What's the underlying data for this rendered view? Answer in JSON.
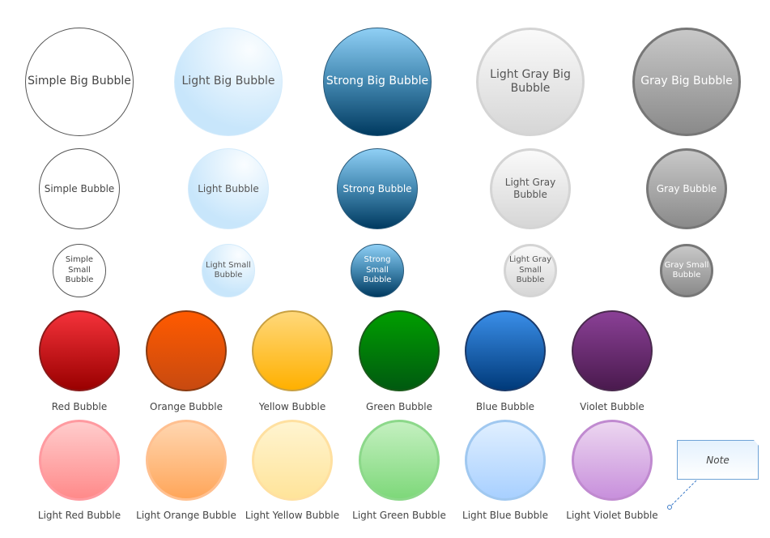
{
  "gray_bubbles": [
    {
      "size": "big",
      "items": [
        {
          "label": "Simple Big Bubble",
          "style": "simple"
        },
        {
          "label": "Light Big Bubble",
          "style": "light"
        },
        {
          "label": "Strong Big Bubble",
          "style": "strong"
        },
        {
          "label": "Light Gray Big Bubble",
          "style": "lightgray"
        },
        {
          "label": "Gray Big Bubble",
          "style": "gray"
        }
      ]
    },
    {
      "size": "medium",
      "items": [
        {
          "label": "Simple Bubble",
          "style": "simple"
        },
        {
          "label": "Light Bubble",
          "style": "light"
        },
        {
          "label": "Strong Bubble",
          "style": "strong"
        },
        {
          "label": "Light Gray Bubble",
          "style": "lightgray"
        },
        {
          "label": "Gray Bubble",
          "style": "gray"
        }
      ]
    },
    {
      "size": "small",
      "items": [
        {
          "label": "Simple Small Bubble",
          "style": "simple"
        },
        {
          "label": "Light Small Bubble",
          "style": "light"
        },
        {
          "label": "Strong Small Bubble",
          "style": "strong"
        },
        {
          "label": "Light Gray Small Bubble",
          "style": "lightgray"
        },
        {
          "label": "Gray Small Bubble",
          "style": "gray"
        }
      ]
    }
  ],
  "color_bubbles": [
    {
      "label": "Red Bubble",
      "top": "#f4323a",
      "bottom": "#9a0000",
      "border": "#8a1a1a"
    },
    {
      "label": "Orange Bubble",
      "top": "#ff5a00",
      "bottom": "#c84a10",
      "border": "#8a3a10"
    },
    {
      "label": "Yellow Bubble",
      "top": "#ffd87a",
      "bottom": "#ffb000",
      "border": "#c9a040"
    },
    {
      "label": "Green Bubble",
      "top": "#009e00",
      "bottom": "#005a10",
      "border": "#1a5a1a"
    },
    {
      "label": "Blue Bubble",
      "top": "#3a8ee8",
      "bottom": "#003a7a",
      "border": "#1a3a6a"
    },
    {
      "label": "Violet Bubble",
      "top": "#8a4096",
      "bottom": "#4a1a4e",
      "border": "#4a2a4e"
    }
  ],
  "light_color_bubbles": [
    {
      "label": "Light Red Bubble",
      "top": "#ffcccc",
      "bottom": "#ff8a8a",
      "border": "#ff9aa0"
    },
    {
      "label": "Light Orange Bubble",
      "top": "#ffd6b0",
      "bottom": "#ffa65a",
      "border": "#ffc090"
    },
    {
      "label": "Light Yellow Bubble",
      "top": "#fff4d0",
      "bottom": "#ffe49a",
      "border": "#ffe0a0"
    },
    {
      "label": "Light Green Bubble",
      "top": "#c4f0c0",
      "bottom": "#7ed87a",
      "border": "#8cd88a"
    },
    {
      "label": "Light Blue Bubble",
      "top": "#e0efff",
      "bottom": "#a8d0ff",
      "border": "#a0c8f0"
    },
    {
      "label": "Light Violet Bubble",
      "top": "#ecd6f0",
      "bottom": "#c890dc",
      "border": "#c08ad0"
    }
  ],
  "note": {
    "label": "Note"
  }
}
